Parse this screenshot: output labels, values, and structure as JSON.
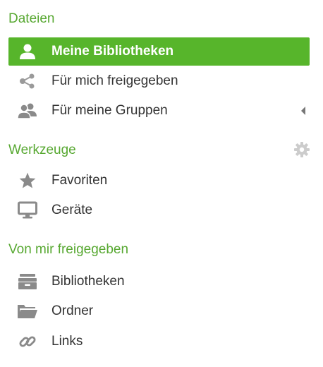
{
  "files_section": {
    "title": "Dateien",
    "items": [
      {
        "label": "Meine Bibliotheken",
        "icon": "user-icon",
        "active": true
      },
      {
        "label": "Für mich freigegeben",
        "icon": "share-icon"
      },
      {
        "label": "Für meine Gruppen",
        "icon": "group-icon"
      }
    ]
  },
  "tools_section": {
    "title": "Werkzeuge",
    "settings_icon": "gear-icon",
    "items": [
      {
        "label": "Favoriten",
        "icon": "star-icon"
      },
      {
        "label": "Geräte",
        "icon": "monitor-icon"
      }
    ]
  },
  "shared_section": {
    "title": "Von mir freigegeben",
    "items": [
      {
        "label": "Bibliotheken",
        "icon": "library-icon"
      },
      {
        "label": "Ordner",
        "icon": "folder-icon"
      },
      {
        "label": "Links",
        "icon": "link-icon"
      }
    ]
  },
  "colors": {
    "accent": "#57b52b",
    "section_title": "#57a831",
    "text": "#333333",
    "icon": "#8a8a8a"
  }
}
